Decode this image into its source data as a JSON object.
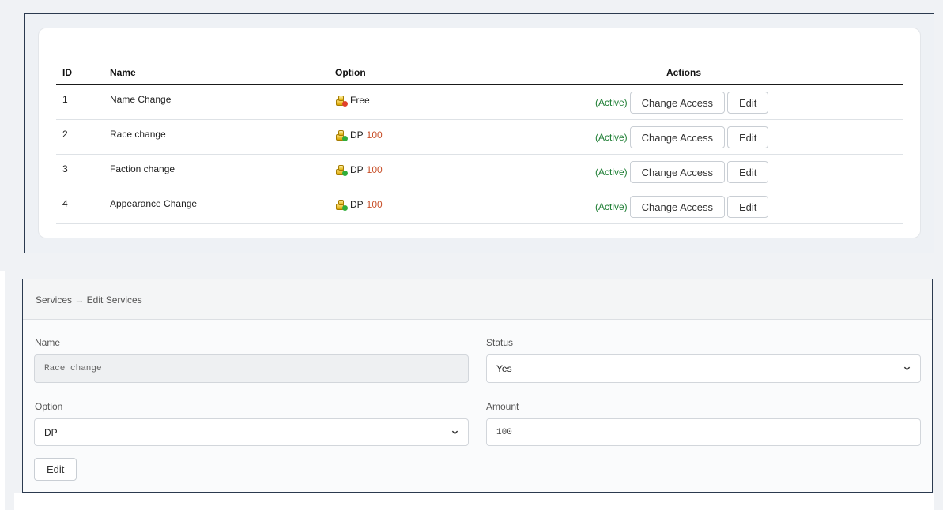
{
  "table": {
    "headers": {
      "id": "ID",
      "name": "Name",
      "option": "Option",
      "actions": "Actions"
    },
    "rows": [
      {
        "id": "1",
        "name": "Name Change",
        "option": "Free",
        "amount": "",
        "icon": "gold-red-icon",
        "status": "(Active)",
        "change_access": "Change Access",
        "edit": "Edit"
      },
      {
        "id": "2",
        "name": "Race change",
        "option": "DP",
        "amount": "100",
        "icon": "gold-green-icon",
        "status": "(Active)",
        "change_access": "Change Access",
        "edit": "Edit"
      },
      {
        "id": "3",
        "name": "Faction change",
        "option": "DP",
        "amount": "100",
        "icon": "gold-green-icon",
        "status": "(Active)",
        "change_access": "Change Access",
        "edit": "Edit"
      },
      {
        "id": "4",
        "name": "Appearance Change",
        "option": "DP",
        "amount": "100",
        "icon": "gold-green-icon",
        "status": "(Active)",
        "change_access": "Change Access",
        "edit": "Edit"
      }
    ]
  },
  "edit_form": {
    "breadcrumb": "Services → Edit Services",
    "name_label": "Name",
    "name_value": "Race change",
    "status_label": "Status",
    "status_value": "Yes",
    "option_label": "Option",
    "option_value": "DP",
    "amount_label": "Amount",
    "amount_value": "100",
    "submit_label": "Edit"
  },
  "colors": {
    "active": "#1e7e34",
    "amount": "#c8502a",
    "border": "#2b3a4f"
  }
}
